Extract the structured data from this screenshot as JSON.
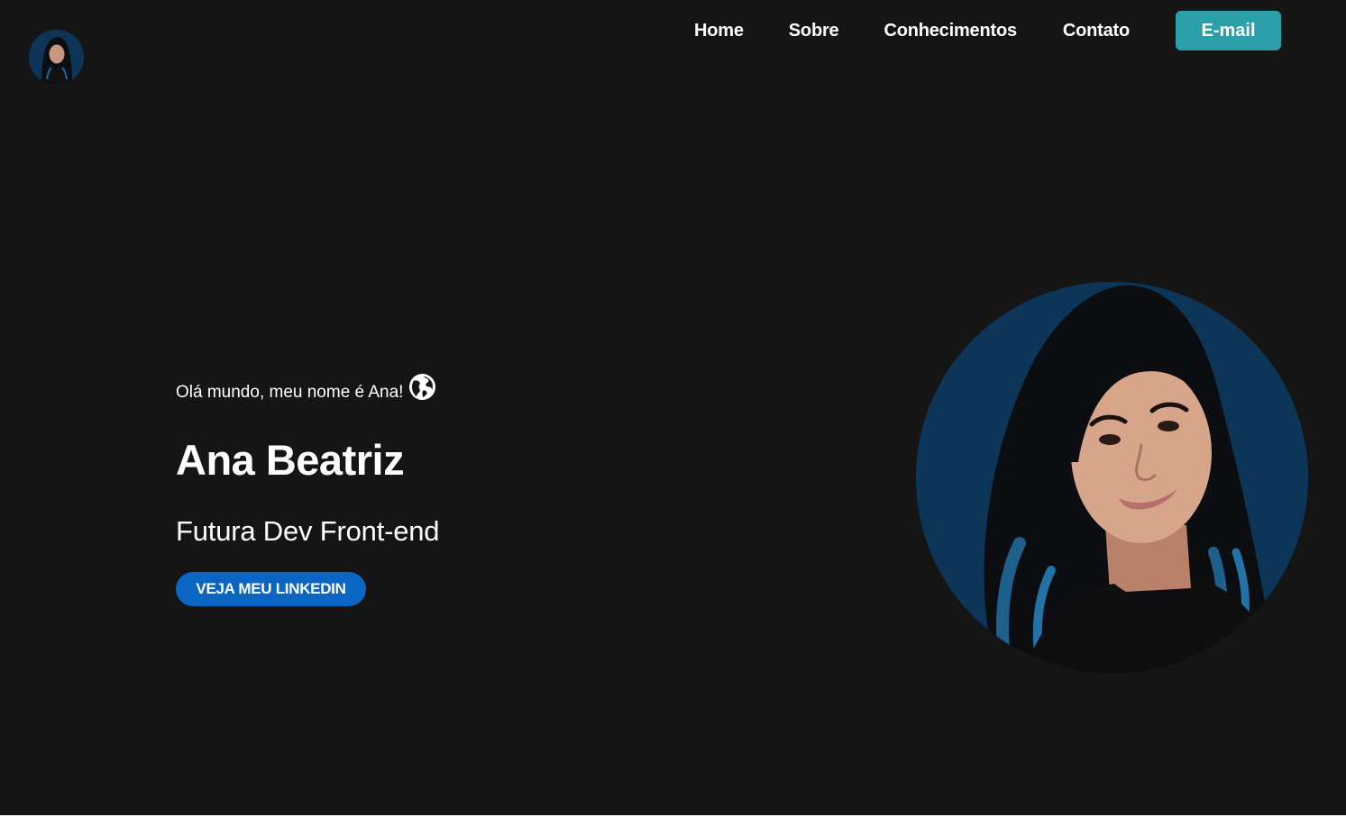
{
  "header": {
    "avatar_icon": "profile-photo",
    "nav": {
      "home": "Home",
      "sobre": "Sobre",
      "conhecimentos": "Conhecimentos",
      "contato": "Contato"
    },
    "email_button": "E-mail"
  },
  "hero": {
    "greeting": "Olá mundo, meu nome é Ana!",
    "greeting_icon": "globe-icon",
    "name": "Ana Beatriz",
    "role": "Futura Dev Front-end",
    "linkedin_button": "VEJA MEU LINKEDIN",
    "portrait_icon": "profile-photo"
  },
  "colors": {
    "background": "#151515",
    "email_button": "#2ca0a8",
    "linkedin_button": "#0a66c2",
    "photo_background": "#0c3557"
  }
}
